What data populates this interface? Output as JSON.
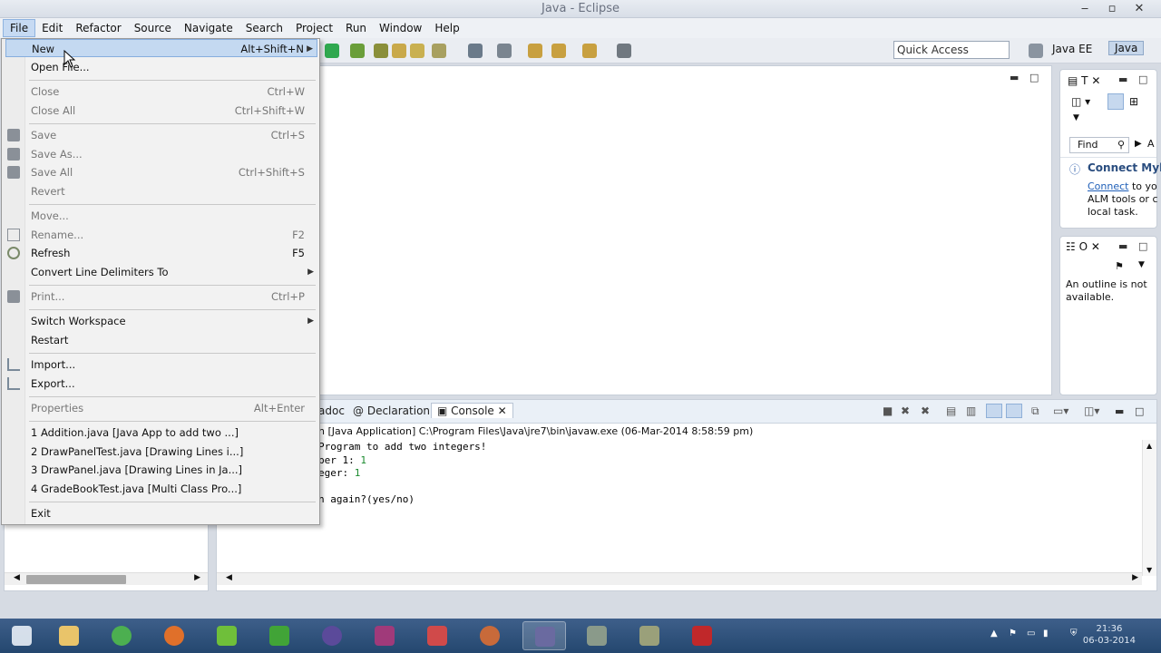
{
  "window": {
    "title": "Java - Eclipse",
    "min": "‒",
    "max": "▫",
    "close": "✕"
  },
  "menubar": [
    "File",
    "Edit",
    "Refactor",
    "Source",
    "Navigate",
    "Search",
    "Project",
    "Run",
    "Window",
    "Help"
  ],
  "toolbar": {
    "quick_access": "Quick Access",
    "perspective_java_ee": "Java EE",
    "perspective_java": "Java"
  },
  "file_menu": {
    "new": {
      "label": "New",
      "shortcut": "Alt+Shift+N"
    },
    "open_file": "Open File...",
    "close": {
      "label": "Close",
      "shortcut": "Ctrl+W"
    },
    "close_all": {
      "label": "Close All",
      "shortcut": "Ctrl+Shift+W"
    },
    "save": {
      "label": "Save",
      "shortcut": "Ctrl+S"
    },
    "save_as": "Save As...",
    "save_all": {
      "label": "Save All",
      "shortcut": "Ctrl+Shift+S"
    },
    "revert": "Revert",
    "move": "Move...",
    "rename": {
      "label": "Rename...",
      "shortcut": "F2"
    },
    "refresh": {
      "label": "Refresh",
      "shortcut": "F5"
    },
    "convert": "Convert Line Delimiters To",
    "print": {
      "label": "Print...",
      "shortcut": "Ctrl+P"
    },
    "switch_workspace": "Switch Workspace",
    "restart": "Restart",
    "import": "Import...",
    "export": "Export...",
    "properties": {
      "label": "Properties",
      "shortcut": "Alt+Enter"
    },
    "recent": [
      "1 Addition.java  [Java App to add two ...]",
      "2 DrawPanelTest.java  [Drawing Lines i...]",
      "3 DrawPanel.java  [Drawing Lines in Ja...]",
      "4 GradeBookTest.java  [Multi Class Pro...]"
    ],
    "exit": "Exit"
  },
  "task_panel": {
    "tab": "T",
    "find": "Find",
    "all": "A",
    "connect_title": "Connect Myl",
    "connect_link": "Connect",
    "connect_text1": " to yo",
    "connect_text2": "ALM tools or c",
    "connect_text3": "local task."
  },
  "outline_panel": {
    "tab": "O",
    "message": "An outline is not available."
  },
  "console": {
    "tab_javadoc": "adoc",
    "tab_declaration": "Declaration",
    "tab_console": "Console",
    "launch": "n [Java Application] C:\\Program Files\\Java\\jre7\\bin\\javaw.exe (06-Mar-2014 8:58:59 pm)",
    "line1": "Program to add two integers!",
    "line2_prefix": "ber 1: ",
    "line2_value": "1",
    "line3_prefix": "eger: ",
    "line3_value": "1",
    "line4": "",
    "line5": "n again?(yes/no)"
  },
  "taskbar": {
    "clock_time": "21:36",
    "clock_date": "06-03-2014"
  },
  "colors": {
    "menu_highlight": "#c4d9f1",
    "taskbar": "#2c5080"
  }
}
